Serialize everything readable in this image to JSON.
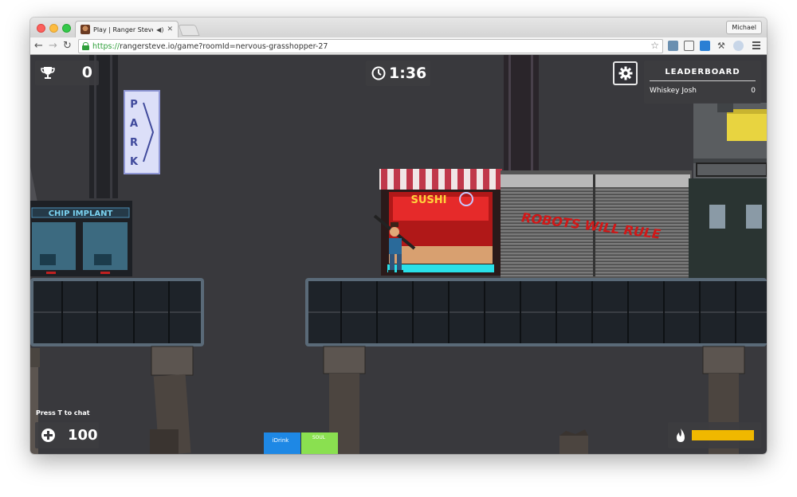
{
  "browser": {
    "tab_title": "Play | Ranger Steve: Bu",
    "profile_name": "Michael",
    "url_scheme": "https://",
    "url_rest": "rangersteve.io/game?roomId=nervous-grasshopper-27"
  },
  "hud": {
    "score": "0",
    "timer": "1:36",
    "leaderboard_title": "LEADERBOARD",
    "leaderboard": [
      {
        "name": "Whiskey Josh",
        "score": "0"
      }
    ],
    "chat_hint": "Press T to chat",
    "health": "100",
    "ammo_fraction": 1.0
  },
  "scene": {
    "park_sign": [
      "P",
      "A",
      "R",
      "K"
    ],
    "chip_sign": "CHIP IMPLANT",
    "sushi_sign": "SUSHI",
    "graffiti": "ROBOTS WILL RULE",
    "vending_left": "iDrink",
    "vending_right": "SOUL"
  },
  "colors": {
    "ammo": "#f0b800",
    "url_secure": "#2e9f3a",
    "graffiti": "#d01818"
  },
  "icons": {
    "score": "trophy-icon",
    "timer": "clock-icon",
    "settings": "gear-icon",
    "health": "plus-icon",
    "ammo": "fire-icon"
  }
}
